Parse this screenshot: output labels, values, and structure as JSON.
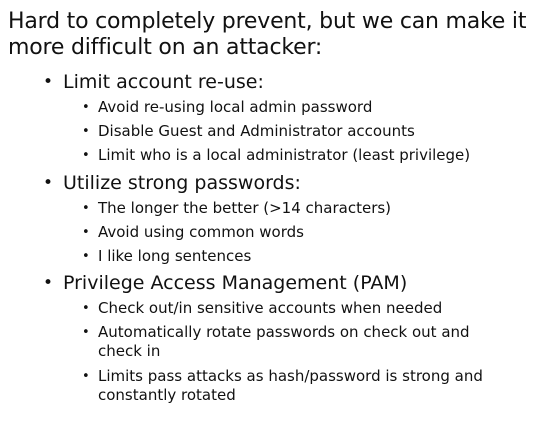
{
  "intro": "Hard to completely prevent, but we can make it more difficult on an attacker:",
  "bullet_glyph": "•",
  "sections": [
    {
      "label": "Limit account re-use:",
      "items": [
        "Avoid re-using local admin password",
        "Disable Guest and Administrator accounts",
        "Limit who is a local administrator (least privilege)"
      ]
    },
    {
      "label": "Utilize strong passwords:",
      "items": [
        "The longer the better (>14 characters)",
        "Avoid using common words",
        "I like long sentences"
      ]
    },
    {
      "label": "Privilege Access Management (PAM)",
      "items": [
        "Check out/in sensitive accounts when needed",
        "Automatically rotate passwords on check out and check in",
        "Limits pass attacks as hash/password is strong and constantly rotated"
      ]
    }
  ]
}
